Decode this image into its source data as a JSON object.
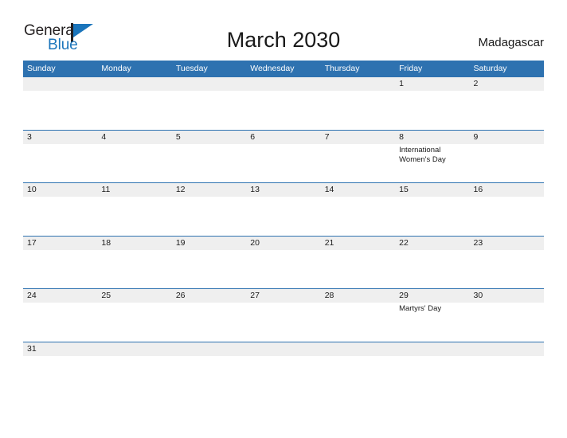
{
  "brand": {
    "name_part1": "General",
    "name_part2": "Blue",
    "flag_icon": "flag-triangle-icon",
    "accent_color": "#1b75bb"
  },
  "header": {
    "title": "March 2030",
    "location": "Madagascar"
  },
  "calendar": {
    "header_bg_color": "#2e72b0",
    "row_band_color": "#efefef",
    "rule_color": "#2e72b0",
    "weekdays": [
      "Sunday",
      "Monday",
      "Tuesday",
      "Wednesday",
      "Thursday",
      "Friday",
      "Saturday"
    ],
    "weeks": [
      {
        "days": [
          {
            "number": "",
            "event": ""
          },
          {
            "number": "",
            "event": ""
          },
          {
            "number": "",
            "event": ""
          },
          {
            "number": "",
            "event": ""
          },
          {
            "number": "",
            "event": ""
          },
          {
            "number": "1",
            "event": ""
          },
          {
            "number": "2",
            "event": ""
          }
        ]
      },
      {
        "days": [
          {
            "number": "3",
            "event": ""
          },
          {
            "number": "4",
            "event": ""
          },
          {
            "number": "5",
            "event": ""
          },
          {
            "number": "6",
            "event": ""
          },
          {
            "number": "7",
            "event": ""
          },
          {
            "number": "8",
            "event": "International Women's Day"
          },
          {
            "number": "9",
            "event": ""
          }
        ]
      },
      {
        "days": [
          {
            "number": "10",
            "event": ""
          },
          {
            "number": "11",
            "event": ""
          },
          {
            "number": "12",
            "event": ""
          },
          {
            "number": "13",
            "event": ""
          },
          {
            "number": "14",
            "event": ""
          },
          {
            "number": "15",
            "event": ""
          },
          {
            "number": "16",
            "event": ""
          }
        ]
      },
      {
        "days": [
          {
            "number": "17",
            "event": ""
          },
          {
            "number": "18",
            "event": ""
          },
          {
            "number": "19",
            "event": ""
          },
          {
            "number": "20",
            "event": ""
          },
          {
            "number": "21",
            "event": ""
          },
          {
            "number": "22",
            "event": ""
          },
          {
            "number": "23",
            "event": ""
          }
        ]
      },
      {
        "days": [
          {
            "number": "24",
            "event": ""
          },
          {
            "number": "25",
            "event": ""
          },
          {
            "number": "26",
            "event": ""
          },
          {
            "number": "27",
            "event": ""
          },
          {
            "number": "28",
            "event": ""
          },
          {
            "number": "29",
            "event": "Martyrs' Day"
          },
          {
            "number": "30",
            "event": ""
          }
        ]
      },
      {
        "days": [
          {
            "number": "31",
            "event": ""
          },
          {
            "number": "",
            "event": ""
          },
          {
            "number": "",
            "event": ""
          },
          {
            "number": "",
            "event": ""
          },
          {
            "number": "",
            "event": ""
          },
          {
            "number": "",
            "event": ""
          },
          {
            "number": "",
            "event": ""
          }
        ]
      }
    ]
  }
}
